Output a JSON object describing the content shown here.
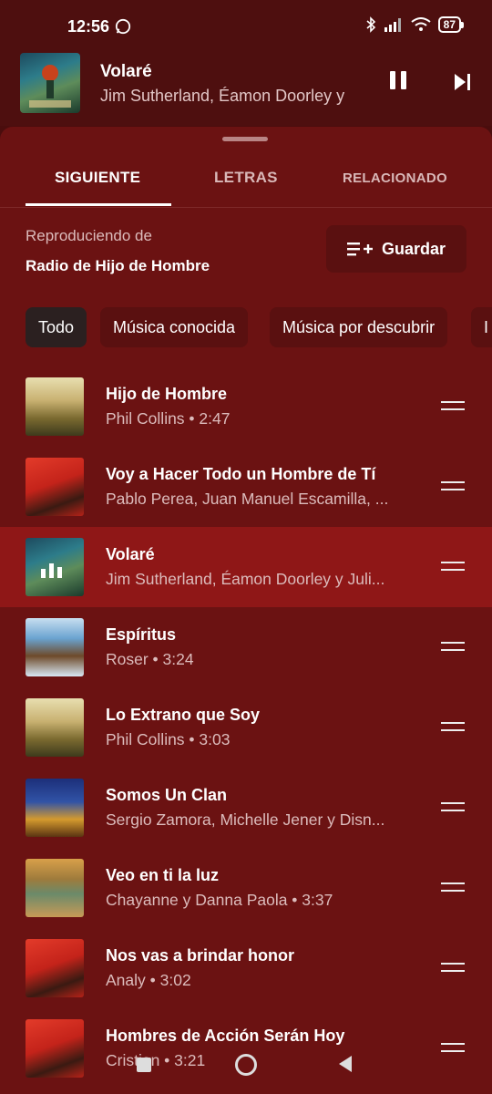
{
  "status": {
    "time": "12:56",
    "battery": "87"
  },
  "now_playing": {
    "title": "Volaré",
    "artist": "Jim Sutherland, Éamon Doorley y"
  },
  "tabs": [
    {
      "label": "Siguiente",
      "active": true
    },
    {
      "label": "Letras",
      "active": false
    },
    {
      "label": "Relacionado",
      "active": false
    }
  ],
  "source": {
    "label": "Reproduciendo de",
    "name": "Radio de Hijo de Hombre",
    "save_label": "Guardar"
  },
  "chips": [
    {
      "label": "Todo",
      "selected": true
    },
    {
      "label": "Música conocida",
      "selected": false
    },
    {
      "label": "Música por descubrir",
      "selected": false
    },
    {
      "label": "I",
      "selected": false
    }
  ],
  "queue": [
    {
      "title": "Hijo de Hombre",
      "subtitle": "Phil Collins • 2:47",
      "art": "tarzan-cover",
      "playing": false
    },
    {
      "title": "Voy a Hacer Todo un Hombre de Tí",
      "subtitle": "Pablo Perea, Juan Manuel Escamilla, ...",
      "art": "mulan-cover",
      "playing": false
    },
    {
      "title": "Volaré",
      "subtitle": "Jim Sutherland, Éamon Doorley y Juli...",
      "art": "brave-cover",
      "playing": true
    },
    {
      "title": "Espíritus",
      "subtitle": "Roser • 3:24",
      "art": "brother-bear-cover",
      "playing": false
    },
    {
      "title": "Lo Extrano que Soy",
      "subtitle": "Phil Collins • 3:03",
      "art": "tarzan-cover",
      "playing": false
    },
    {
      "title": "Somos Un Clan",
      "subtitle": "Sergio Zamora, Michelle Jener y Disn...",
      "art": "lion-king-cover",
      "playing": false
    },
    {
      "title": "Veo en ti la luz",
      "subtitle": "Chayanne y Danna Paola • 3:37",
      "art": "tangled-cover",
      "playing": false
    },
    {
      "title": "Nos vas a brindar honor",
      "subtitle": "Analy • 3:02",
      "art": "mulan-cover",
      "playing": false
    },
    {
      "title": "Hombres de Acción Serán Hoy",
      "subtitle": "Cristian • 3:21",
      "art": "mulan-cover",
      "playing": false
    }
  ],
  "colors": {
    "background": "#6b1212",
    "playing_row": "#8f1717",
    "header": "#4e0f0f"
  }
}
